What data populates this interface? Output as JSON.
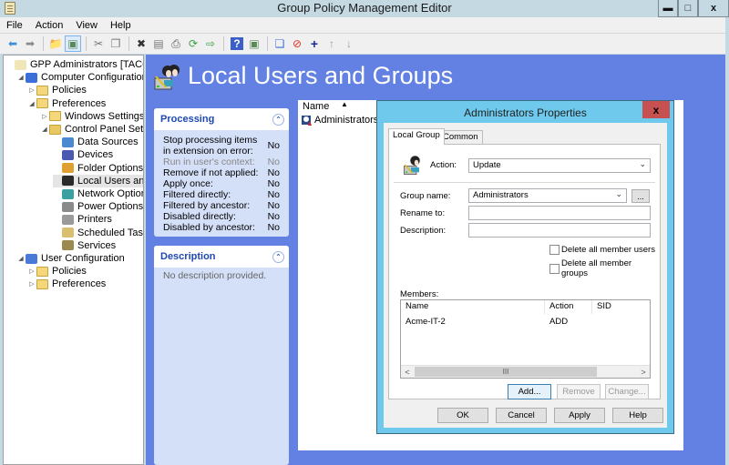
{
  "window": {
    "title": "Group Policy Management Editor",
    "controls": {
      "minimize": "▬",
      "maximize": "□",
      "close": "x"
    }
  },
  "menubar": {
    "items": [
      "File",
      "Action",
      "View",
      "Help"
    ]
  },
  "toolbar": {
    "buttons": [
      {
        "name": "back-icon",
        "glyph": "⬅",
        "color": "#3a8fd8"
      },
      {
        "name": "forward-icon",
        "glyph": "➡",
        "color": "#8a8a8a"
      },
      {
        "name": "up-level-icon",
        "glyph": "📁",
        "color": "#e0b030"
      },
      {
        "name": "show-hide-tree-icon",
        "glyph": "▣",
        "color": "#5a8a5a"
      },
      {
        "name": "cut-icon",
        "glyph": "✂",
        "color": "#777"
      },
      {
        "name": "copy-icon",
        "glyph": "❐",
        "color": "#777"
      },
      {
        "name": "delete-icon",
        "glyph": "✖",
        "color": "#333"
      },
      {
        "name": "properties-icon",
        "glyph": "▤",
        "color": "#777"
      },
      {
        "name": "print-icon",
        "glyph": "⎙",
        "color": "#555"
      },
      {
        "name": "refresh-icon",
        "glyph": "⟳",
        "color": "#3aa040"
      },
      {
        "name": "export-list-icon",
        "glyph": "⇨",
        "color": "#3aa040"
      },
      {
        "name": "help-icon",
        "glyph": "?",
        "color": "#ffffff"
      },
      {
        "name": "show-action-pane-icon",
        "glyph": "▣",
        "color": "#5a8a5a"
      },
      {
        "name": "new-item-icon",
        "glyph": "❏",
        "color": "#3a6fd8"
      },
      {
        "name": "stop-icon",
        "glyph": "⊘",
        "color": "#e03020"
      },
      {
        "name": "add-icon",
        "glyph": "+",
        "color": "#1a2a9a"
      },
      {
        "name": "move-up-icon",
        "glyph": "↑",
        "color": "#999"
      },
      {
        "name": "move-down-icon",
        "glyph": "↓",
        "color": "#999"
      }
    ]
  },
  "tree": {
    "items": [
      {
        "label": "GPP Administrators [TACO.ACM",
        "icon": "policy-scroll-icon",
        "twisty": ""
      },
      {
        "label": "Computer Configuration",
        "icon": "computer-icon",
        "twisty": "◢"
      },
      {
        "label": "Policies",
        "icon": "folder-icon",
        "twisty": "▷"
      },
      {
        "label": "Preferences",
        "icon": "folder-icon",
        "twisty": "◢"
      },
      {
        "label": "Windows Settings",
        "icon": "folder-icon",
        "twisty": "▷"
      },
      {
        "label": "Control Panel Settings",
        "icon": "control-panel-folder-icon",
        "twisty": "◢"
      },
      {
        "label": "Data Sources",
        "icon": "data-sources-icon",
        "twisty": ""
      },
      {
        "label": "Devices",
        "icon": "devices-icon",
        "twisty": ""
      },
      {
        "label": "Folder Options",
        "icon": "folder-options-icon",
        "twisty": ""
      },
      {
        "label": "Local Users and Groups",
        "icon": "local-users-icon",
        "twisty": ""
      },
      {
        "label": "Network Options",
        "icon": "network-options-icon",
        "twisty": ""
      },
      {
        "label": "Power Options",
        "icon": "power-options-icon",
        "twisty": ""
      },
      {
        "label": "Printers",
        "icon": "printers-icon",
        "twisty": ""
      },
      {
        "label": "Scheduled Tasks",
        "icon": "scheduled-tasks-icon",
        "twisty": ""
      },
      {
        "label": "Services",
        "icon": "services-icon",
        "twisty": ""
      },
      {
        "label": "User Configuration",
        "icon": "user-icon",
        "twisty": "◢"
      },
      {
        "label": "Policies",
        "icon": "folder-icon",
        "twisty": "▷"
      },
      {
        "label": "Preferences",
        "icon": "folder-icon",
        "twisty": "▷"
      }
    ],
    "selected_index": 9
  },
  "main": {
    "title": "Local Users and Groups",
    "processing": {
      "title": "Processing",
      "rows": [
        {
          "label": "Stop processing items in extension on error:",
          "value": "No",
          "muted": false
        },
        {
          "label": "Run in user's context:",
          "value": "No",
          "muted": true
        },
        {
          "label": "Remove if not applied:",
          "value": "No",
          "muted": false
        },
        {
          "label": "Apply once:",
          "value": "No",
          "muted": false
        },
        {
          "label": "Filtered directly:",
          "value": "No",
          "muted": false
        },
        {
          "label": "Filtered by ancestor:",
          "value": "No",
          "muted": false
        },
        {
          "label": "Disabled directly:",
          "value": "No",
          "muted": false
        },
        {
          "label": "Disabled by ancestor:",
          "value": "No",
          "muted": false
        }
      ]
    },
    "description": {
      "title": "Description",
      "text": "No description provided."
    },
    "list": {
      "column_name": "Name",
      "sort_indicator": "▲",
      "rows": [
        "Administrators"
      ]
    }
  },
  "dialog": {
    "title": "Administrators Properties",
    "close": "x",
    "tabs": [
      "Local Group",
      "Common"
    ],
    "active_tab": 0,
    "action_label": "Action:",
    "action_value": "Update",
    "group_name_label": "Group name:",
    "group_name_value": "Administrators",
    "browse_label": "...",
    "rename_label": "Rename to:",
    "rename_value": "",
    "description_label": "Description:",
    "description_value": "",
    "checkboxes": [
      {
        "label": "Delete all member users",
        "checked": false
      },
      {
        "label": "Delete all member groups",
        "checked": false
      }
    ],
    "members_label": "Members:",
    "members_columns": [
      "Name",
      "Action",
      "SID"
    ],
    "members_rows": [
      {
        "name": "Acme-IT-2",
        "action": "ADD",
        "sid": ""
      }
    ],
    "scroll_thumb_grip": "III",
    "scroll_left": "<",
    "scroll_right": ">",
    "member_buttons": {
      "add": "Add...",
      "remove": "Remove",
      "change": "Change..."
    },
    "footer_buttons": {
      "ok": "OK",
      "cancel": "Cancel",
      "apply": "Apply",
      "help": "Help"
    }
  },
  "colors": {
    "accent_blue": "#6281e3",
    "panel_bg": "#d4dff8",
    "panel_title": "#1d48b3",
    "dialog_frame": "#6ec9ec",
    "close_red": "#c75050"
  }
}
